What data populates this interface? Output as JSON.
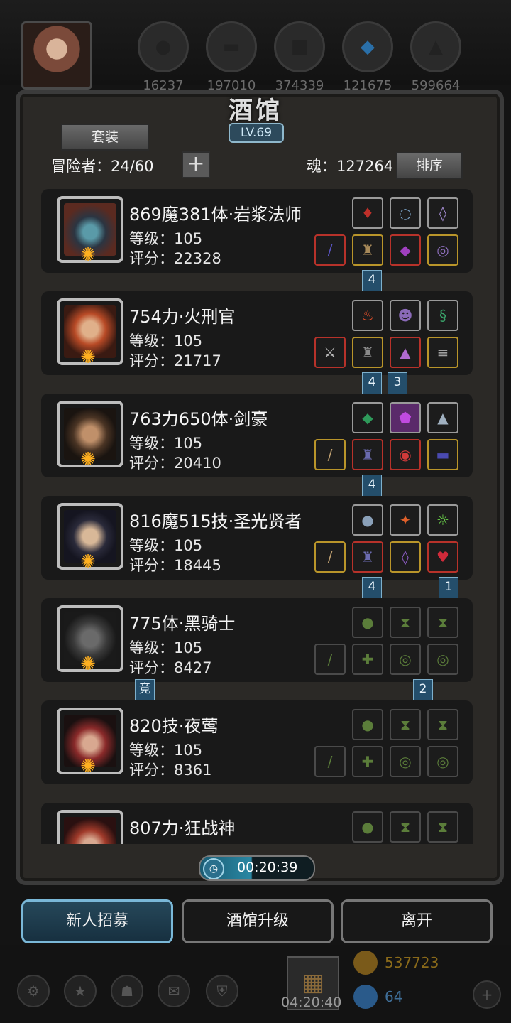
{
  "topbar": {
    "resources": [
      {
        "icon": "meat-icon",
        "value": "16237"
      },
      {
        "icon": "wood-icon",
        "value": "197010"
      },
      {
        "icon": "stone-icon",
        "value": "374339"
      },
      {
        "icon": "crystal-icon",
        "value": "121675"
      },
      {
        "icon": "iron-icon",
        "value": "599664"
      }
    ]
  },
  "tavern": {
    "title": "酒馆",
    "level": "LV.69",
    "set_button": "套装",
    "adventurers_label": "冒险者：24/60",
    "soul_label": "魂：127264",
    "sort_button": "排序"
  },
  "heroes": [
    {
      "name": "869魔381体·岩浆法师",
      "level": "等级：105",
      "score": "评分：22328"
    },
    {
      "name": "754力·火刑官",
      "level": "等级：105",
      "score": "评分：21717"
    },
    {
      "name": "763力650体·剑豪",
      "level": "等级：105",
      "score": "评分：20410"
    },
    {
      "name": "816魔515技·圣光贤者",
      "level": "等级：105",
      "score": "评分：18445"
    },
    {
      "name": "775体·黑骑士",
      "level": "等级：105",
      "score": "评分：8427"
    },
    {
      "name": "820技·夜莺",
      "level": "等级：105",
      "score": "评分：8361"
    },
    {
      "name": "807力·狂战神",
      "level": "",
      "score": ""
    }
  ],
  "tags": {
    "t1": "4",
    "t2a": "4",
    "t2b": "3",
    "t3": "4",
    "t4a": "4",
    "t4b": "1",
    "t5a": "竞",
    "t5b": "2"
  },
  "timer": "00:20:39",
  "buttons": {
    "recruit": "新人招募",
    "upgrade": "酒馆升级",
    "leave": "离开"
  },
  "footer": {
    "gift_timer": "04:20:40",
    "gold": "537723",
    "gems": "64"
  },
  "colors": {
    "accent": "#7ab8d8",
    "gold_text": "#8a6a1a",
    "gem_text": "#3f6f99"
  }
}
